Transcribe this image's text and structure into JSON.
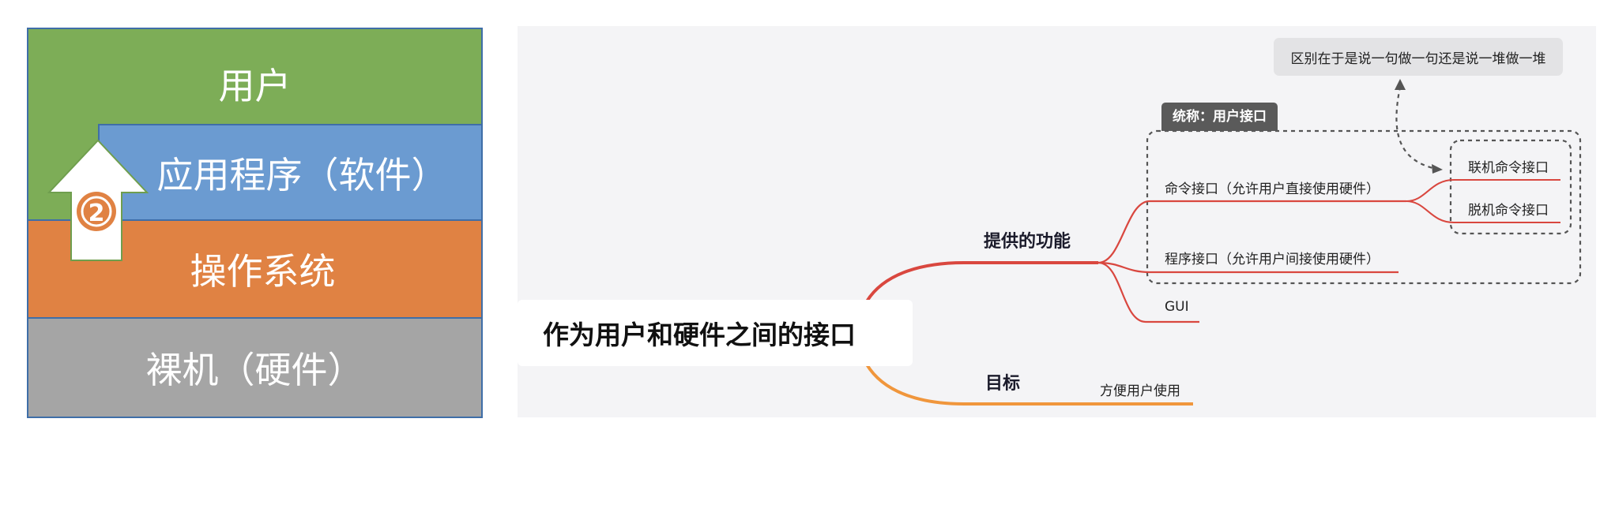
{
  "layer_diagram": {
    "layers": {
      "user": "用户",
      "application": "应用程序（软件）",
      "os": "操作系统",
      "hardware": "裸机（硬件）"
    },
    "arrow_badge": "2",
    "colors": {
      "user": "#7dad57",
      "application": "#6b9bd1",
      "os": "#e08243",
      "hardware": "#a5a5a5",
      "arrow_badge": "#e08243"
    }
  },
  "mind_map": {
    "root": "作为用户和硬件之间的接口",
    "branches": {
      "functions": {
        "label": "提供的功能",
        "items": {
          "command_interface": "命令接口（允许用户直接使用硬件）",
          "program_interface": "程序接口（允许用户间接使用硬件）",
          "gui": "GUI"
        },
        "command_children": {
          "online": "联机命令接口",
          "offline": "脱机命令接口"
        },
        "summary": "统称：用户接口"
      },
      "goal": {
        "label": "目标",
        "item": "方便用户使用"
      }
    },
    "note": "区别在于是说一句做一句还是说一堆做一堆",
    "colors": {
      "functions_branch": "#d9473f",
      "goal_branch": "#f0963c",
      "background": "#f4f4f6"
    }
  }
}
